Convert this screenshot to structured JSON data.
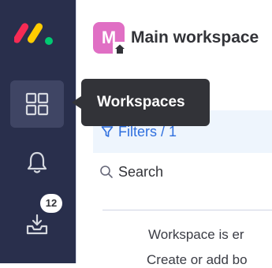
{
  "rail": {
    "workspaces_badge_count": "12",
    "colors": {
      "background": "#292f4c",
      "active": "#3f4564"
    },
    "icons": [
      "monday-logo-icon",
      "workspaces-grid-icon",
      "bell-icon",
      "inbox-download-icon"
    ]
  },
  "workspace": {
    "avatar_letter": "M",
    "name": "Main workspace",
    "avatar_color": "#e06fc4"
  },
  "filters": {
    "label": "Filters / 1"
  },
  "search": {
    "placeholder": "Search"
  },
  "empty_state": {
    "line1": "Workspace is er",
    "line2": "Create or add bo"
  },
  "tooltip": {
    "label": "Workspaces"
  }
}
